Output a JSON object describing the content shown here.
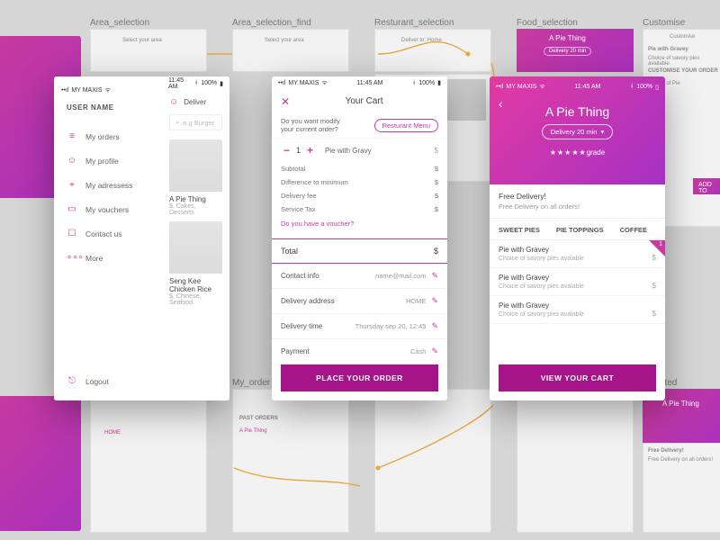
{
  "bg_labels": {
    "area_selection": "Area_selection",
    "area_selection_find": "Area_selection_find",
    "restaurant_selection": "Resturant_selection",
    "food_selection": "Food_selection",
    "customise": "Customise",
    "my_order": "My_order",
    "detected": "detected",
    "select_your_area": "Select your area",
    "deliver_to_home": "Deliver to:   Home",
    "a_pie_thing": "A Pie Thing",
    "delivery_20": "Delivery 20 min",
    "free_delivery": "Free Delivery!",
    "free_delivery_sub": "Free Delivery on all orders!",
    "pie_with_gravey": "Pie with Gravey",
    "customise_title": "Customise",
    "customise_your_order": "CUSTOMISE YOUR ORDER",
    "choice_of_pie": "Choice of Pie",
    "add_to": "ADD TO",
    "choice_savory": "Choice of savory pies available",
    "home": "HOME",
    "past_orders": "PAST ORDERS",
    "grade": "grade"
  },
  "status": {
    "carrier": "MY MAXIS",
    "time": "11:45 AM",
    "battery": "100%"
  },
  "p1": {
    "user_name": "USER NAME",
    "menu": [
      {
        "icon": "≡",
        "label": "My orders",
        "name": "menu-my-orders"
      },
      {
        "icon": "☺",
        "label": "My profile",
        "name": "menu-my-profile"
      },
      {
        "icon": "⌖",
        "label": "My adressess",
        "name": "menu-my-addresses"
      },
      {
        "icon": "▭",
        "label": "My vouchers",
        "name": "menu-my-vouchers"
      },
      {
        "icon": "☐",
        "label": "Contact us",
        "name": "menu-contact-us"
      },
      {
        "icon": "∘∘∘",
        "label": "More",
        "name": "menu-more"
      }
    ],
    "logout": "Logout",
    "deliver": "Deliver",
    "search_placeholder": "e.g Burger",
    "cards": [
      {
        "title": "A Pie Thing",
        "sub": "$, Cakes, Desserts"
      },
      {
        "title": "Seng Kee Chicken Rice",
        "sub": "$, Chinese, Seafood"
      }
    ]
  },
  "p2": {
    "title": "Your Cart",
    "modify_q": "Do you want modify your current order?",
    "rest_menu": "Resturant Menu",
    "qty": "1",
    "item_name": "Pie with Gravy",
    "dollar": "$",
    "lines": [
      "Subtotal",
      "Difference to minimum",
      "Delivery fee",
      "Service Tax"
    ],
    "voucher": "Do you have a voucher?",
    "total": "Total",
    "info": [
      {
        "label": "Contact info",
        "value": "name@mail.com",
        "name": "row-contact"
      },
      {
        "label": "Delivery address",
        "value": "HOME",
        "name": "row-address"
      },
      {
        "label": "Delivery time",
        "value": "Thursday sep 20, 12:45",
        "name": "row-time"
      },
      {
        "label": "Payment",
        "value": "Cash",
        "name": "row-payment"
      }
    ],
    "cta": "PLACE YOUR ORDER"
  },
  "p3": {
    "title": "A Pie Thing",
    "delivery": "Delivery 20 min",
    "grade": "grade",
    "fd_title": "Free Delivery!",
    "fd_sub": "Free Delivery on all orders!",
    "tabs": [
      "SWEET PIES",
      "PIE TOPPINGS",
      "COFFEE"
    ],
    "foods": [
      {
        "title": "Pie with Gravey",
        "sub": "Choice of savory pies avalable",
        "price": "$",
        "badge": "1"
      },
      {
        "title": "Pie with Gravey",
        "sub": "Choice of savory pies avalable",
        "price": "$"
      },
      {
        "title": "Pie with Gravey",
        "sub": "Choice of savory pies avalable",
        "price": "$"
      }
    ],
    "cta": "VIEW YOUR CART"
  }
}
